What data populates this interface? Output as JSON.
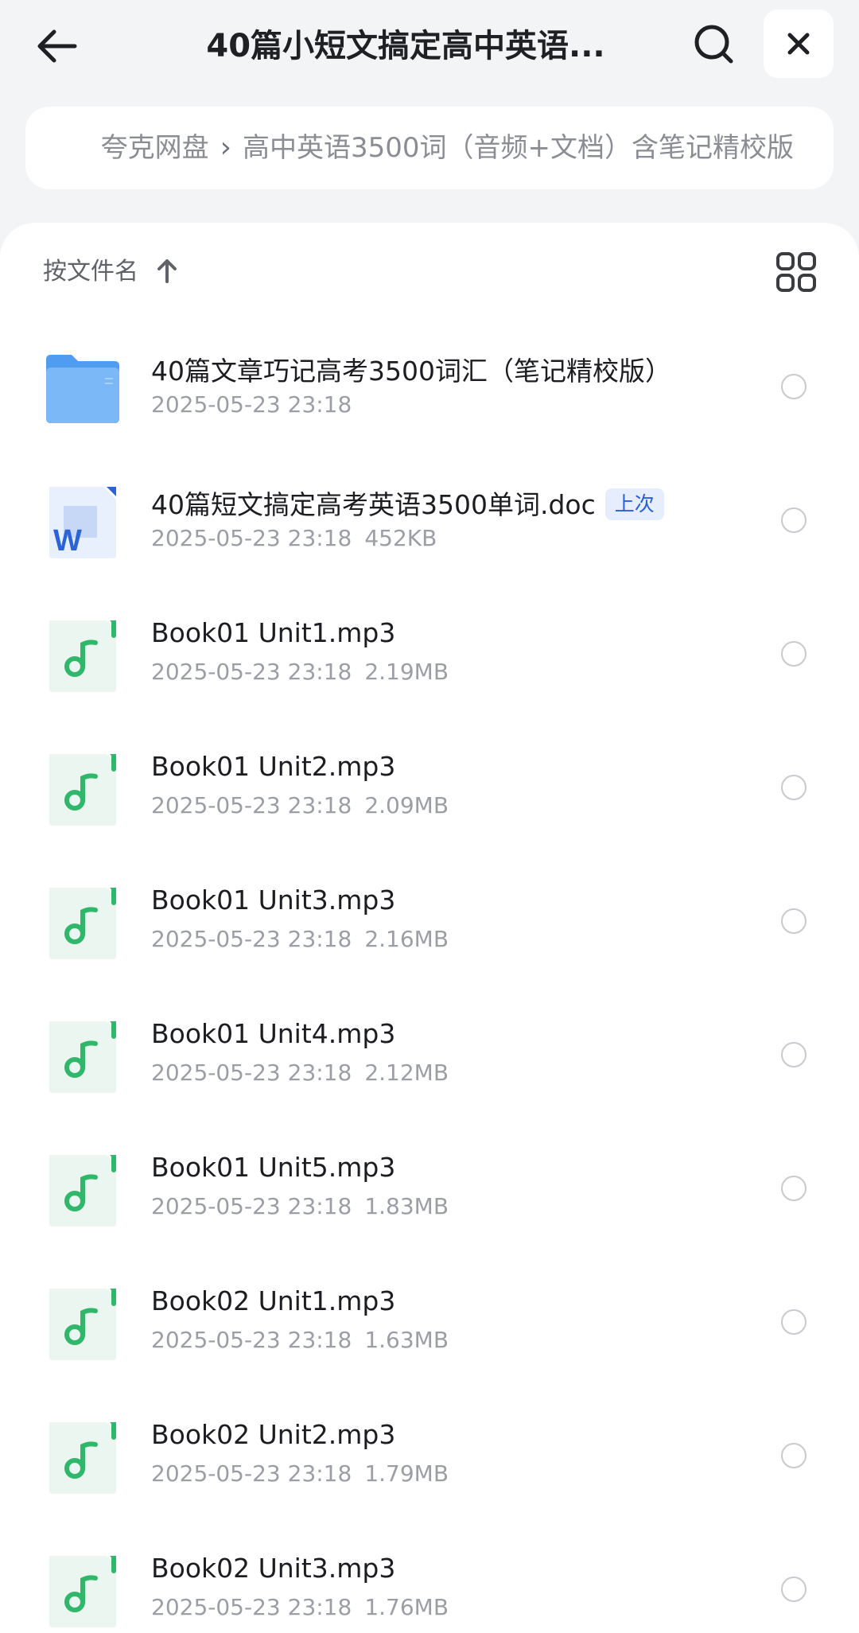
{
  "header": {
    "title": "40篇小短文搞定高中英语...",
    "back_icon": "arrow-left-icon",
    "search_icon": "search-icon",
    "close_icon": "close-icon"
  },
  "breadcrumb": {
    "root": "夸克网盘",
    "current": "高中英语3500词（音频+文档）含笔记精校版"
  },
  "sort": {
    "label": "按文件名",
    "direction_icon": "arrow-up-icon",
    "view_icon": "grid-view-icon"
  },
  "colors": {
    "accent": "#2b5fd9",
    "folder": "#5aa6f2",
    "audio": "#2fb86a",
    "word": "#2a64d6"
  },
  "files": [
    {
      "type": "folder",
      "name": "40篇文章巧记高考3500词汇（笔记精校版）",
      "date": "2025-05-23 23:18",
      "size": "",
      "badge": ""
    },
    {
      "type": "doc",
      "name": "40篇短文搞定高考英语3500单词.doc",
      "date": "2025-05-23 23:18",
      "size": "452KB",
      "badge": "上次"
    },
    {
      "type": "audio",
      "name": "Book01 Unit1.mp3",
      "date": "2025-05-23 23:18",
      "size": "2.19MB",
      "badge": ""
    },
    {
      "type": "audio",
      "name": "Book01 Unit2.mp3",
      "date": "2025-05-23 23:18",
      "size": "2.09MB",
      "badge": ""
    },
    {
      "type": "audio",
      "name": "Book01 Unit3.mp3",
      "date": "2025-05-23 23:18",
      "size": "2.16MB",
      "badge": ""
    },
    {
      "type": "audio",
      "name": "Book01 Unit4.mp3",
      "date": "2025-05-23 23:18",
      "size": "2.12MB",
      "badge": ""
    },
    {
      "type": "audio",
      "name": "Book01 Unit5.mp3",
      "date": "2025-05-23 23:18",
      "size": "1.83MB",
      "badge": ""
    },
    {
      "type": "audio",
      "name": "Book02 Unit1.mp3",
      "date": "2025-05-23 23:18",
      "size": "1.63MB",
      "badge": ""
    },
    {
      "type": "audio",
      "name": "Book02 Unit2.mp3",
      "date": "2025-05-23 23:18",
      "size": "1.79MB",
      "badge": ""
    },
    {
      "type": "audio",
      "name": "Book02 Unit3.mp3",
      "date": "2025-05-23 23:18",
      "size": "1.76MB",
      "badge": ""
    }
  ]
}
